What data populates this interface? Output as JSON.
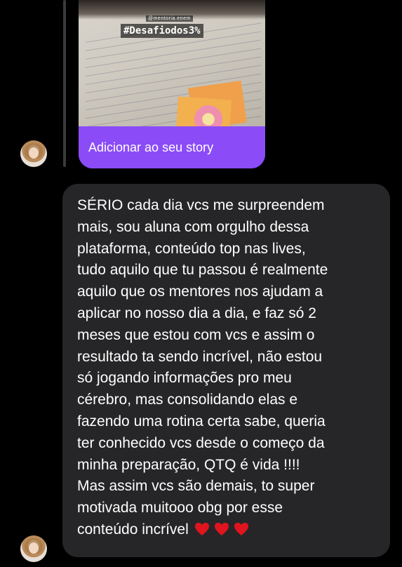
{
  "story": {
    "handle": "@mentoria.enem",
    "hashtag": "#Desafiodos3%",
    "action_label": "Adicionar ao seu story"
  },
  "message": {
    "lines": [
      "SÉRIO cada dia vcs me surpreendem",
      "mais, sou aluna com orgulho dessa",
      "plataforma, conteúdo top nas lives,",
      "tudo aquilo que tu passou é realmente",
      "aquilo que os mentores nos ajudam a",
      "aplicar no nosso dia a dia, e faz só 2",
      "meses que estou com vcs e assim o",
      "resultado ta sendo incrível, não estou",
      "só jogando informações pro meu",
      "cérebro, mas consolidando elas e",
      "fazendo uma rotina certa sabe, queria",
      "ter conhecido vcs desde o começo da",
      "minha preparação, QTQ é vida !!!!",
      "Mas assim vcs são demais, to super",
      "motivada muitooo obg por esse",
      "conteúdo incrível"
    ],
    "emoji": [
      "red-heart-icon",
      "red-heart-icon",
      "red-heart-icon"
    ]
  },
  "colors": {
    "background": "#000000",
    "bubble": "#262628",
    "story_action": "#8b4cf7",
    "text": "#ffffff",
    "heart": "#e0141e"
  }
}
